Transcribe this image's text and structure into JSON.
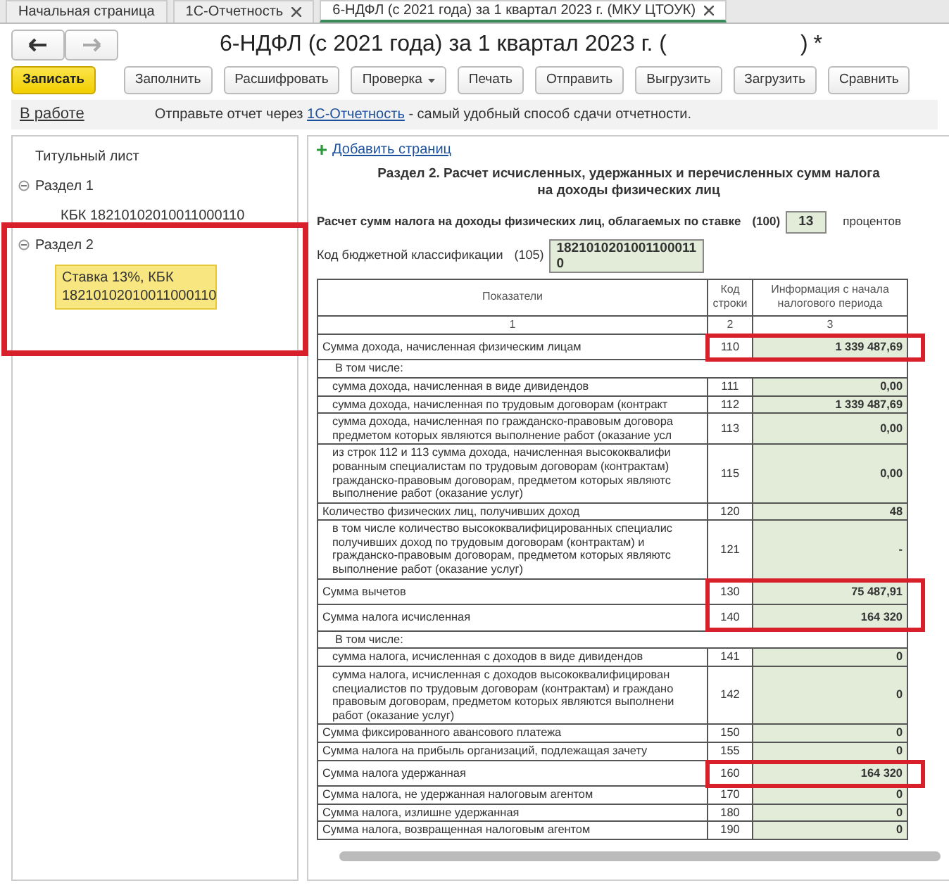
{
  "tabs": [
    {
      "label": "Начальная страница",
      "closable": false,
      "selected": false
    },
    {
      "label": "1С-Отчетность",
      "closable": true,
      "selected": false
    },
    {
      "label": "6-НДФЛ (с 2021 года) за 1 квартал 2023 г. (МКУ ЦТОУК)",
      "closable": true,
      "selected": true
    }
  ],
  "nav": {
    "back_disabled": false,
    "forward_disabled": true
  },
  "title": {
    "prefix": "6-НДФЛ (с 2021 года) за 1 квартал 2023 г. (",
    "suffix": ")",
    "modified_mark": "*"
  },
  "toolbar": [
    {
      "label": "Записать",
      "kind": "primary"
    },
    {
      "label": "Заполнить",
      "kind": "plain"
    },
    {
      "label": "Расшифровать",
      "kind": "plain"
    },
    {
      "label": "Проверка",
      "kind": "dropdown"
    },
    {
      "label": "Печать",
      "kind": "plain"
    },
    {
      "label": "Отправить",
      "kind": "plain"
    },
    {
      "label": "Выгрузить",
      "kind": "plain"
    },
    {
      "label": "Загрузить",
      "kind": "plain"
    },
    {
      "label": "Сравнить",
      "kind": "plain"
    }
  ],
  "info_bar": {
    "status": "В работе",
    "text_before": "Отправьте отчет через ",
    "link": "1С-Отчетность",
    "text_after": " - самый удобный способ сдачи отчетности."
  },
  "tree": [
    {
      "label": "Титульный лист",
      "selected": false
    },
    {
      "label": "Раздел 1",
      "expanded": true,
      "selected": false,
      "children": [
        {
          "label": "КБК 18210102010011000110",
          "selected": false
        }
      ]
    },
    {
      "label": "Раздел 2",
      "expanded": true,
      "selected": false,
      "highlighted": true,
      "children": [
        {
          "label": "Ставка 13%, КБК 18210102010011000110",
          "selected": true
        }
      ]
    }
  ],
  "form": {
    "add_page": "Добавить страниц",
    "section_title": "Раздел 2. Расчет исчисленных, удержанных и перечисленных сумм налога\nна доходы физических лиц",
    "rate": {
      "label": "Расчет сумм налога на доходы физических лиц, облагаемых по ставке",
      "code": "(100)",
      "value": "13",
      "suffix": "процентов"
    },
    "kbk": {
      "label": "Код бюджетной классификации",
      "code": "(105)",
      "value": "1821010201001100011\n0"
    },
    "table": {
      "columns": [
        "Показатели",
        "Код\nстроки",
        "Информация с начала\nналогового периода"
      ],
      "column_numbers": [
        "1",
        "2",
        "3"
      ],
      "rows": [
        {
          "kind": "total",
          "label": "Сумма дохода, начисленная физическим лицам",
          "code": "110",
          "value": "1 339 487,69",
          "highlighted": true
        },
        {
          "kind": "heading",
          "label": "В том числе:"
        },
        {
          "kind": "sub",
          "label": "сумма дохода, начисленная в виде дивидендов",
          "code": "111",
          "value": "0,00",
          "highlighted": false
        },
        {
          "kind": "sub",
          "label": "сумма дохода, начисленная по трудовым договорам (контракт",
          "code": "112",
          "value": "1 339 487,69",
          "highlighted": false
        },
        {
          "kind": "sub",
          "label": "сумма дохода, начисленная по гражданско-правовым договора\nпредметом которых являются выполнение работ (оказание усл",
          "code": "113",
          "value": "0,00",
          "highlighted": false
        },
        {
          "kind": "sub",
          "label": "из строк 112 и 113 сумма дохода, начисленная высококвалифи\nрованным специалистам по трудовым договорам (контрактам)\nгражданско-правовым договорам, предметом которых являютс\nвыполнение работ (оказание услуг)",
          "code": "115",
          "value": "0,00",
          "highlighted": false
        },
        {
          "kind": "total",
          "label": "Количество физических лиц, получивших доход",
          "code": "120",
          "value": "48",
          "highlighted": false
        },
        {
          "kind": "sub",
          "label": "в том числе количество высококвалифицированных специалис\nполучивших доход по трудовым договорам (контрактам) и\nгражданско-правовым договорам, предметом которых являютс\nвыполнение работ (оказание услуг)",
          "code": "121",
          "value": "-",
          "highlighted": false
        },
        {
          "kind": "total",
          "label": "Сумма вычетов",
          "code": "130",
          "value": "75 487,91",
          "highlighted": true
        },
        {
          "kind": "total",
          "label": "Сумма налога исчисленная",
          "code": "140",
          "value": "164 320",
          "highlighted": true
        },
        {
          "kind": "heading",
          "label": "В том числе:"
        },
        {
          "kind": "sub",
          "label": "сумма налога, исчисленная с доходов в виде дивидендов",
          "code": "141",
          "value": "0",
          "highlighted": false
        },
        {
          "kind": "sub",
          "label": "сумма налога, исчисленная с доходов высококвалифицирован\nспециалистов по трудовым договорам (контрактам) и граждано\nправовым договорам, предметом которых являются выполнени\nработ (оказание услуг)",
          "code": "142",
          "value": "0",
          "highlighted": false
        },
        {
          "kind": "total",
          "label": "Сумма фиксированного авансового платежа",
          "code": "150",
          "value": "0",
          "highlighted": false
        },
        {
          "kind": "total",
          "label": "Сумма налога на прибыль организаций, подлежащая зачету",
          "code": "155",
          "value": "0",
          "highlighted": false
        },
        {
          "kind": "total",
          "label": "Сумма налога удержанная",
          "code": "160",
          "value": "164 320",
          "highlighted": true
        },
        {
          "kind": "total",
          "label": "Сумма налога, не удержанная налоговым агентом",
          "code": "170",
          "value": "0",
          "highlighted": false
        },
        {
          "kind": "total",
          "label": "Сумма налога, излишне удержанная",
          "code": "180",
          "value": "0",
          "highlighted": false
        },
        {
          "kind": "total",
          "label": "Сумма налога, возвращенная налоговым агентом",
          "code": "190",
          "value": "0",
          "highlighted": false
        }
      ]
    }
  }
}
